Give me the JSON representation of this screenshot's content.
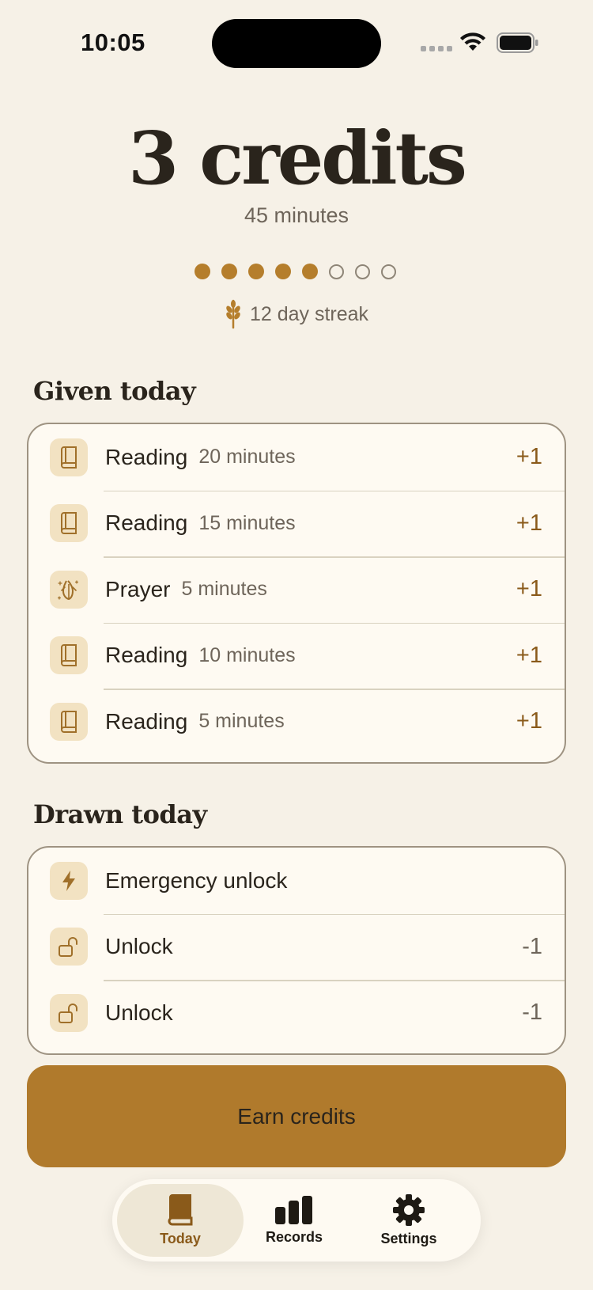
{
  "status_bar": {
    "time": "10:05"
  },
  "summary": {
    "credits_title": "3 credits",
    "minutes": "45 minutes",
    "progress": {
      "filled": 5,
      "total": 8
    },
    "streak": "12 day streak"
  },
  "given": {
    "title": "Given today",
    "rows": [
      {
        "icon": "book-icon",
        "label": "Reading",
        "sub": "20 minutes",
        "value": "+1"
      },
      {
        "icon": "book-icon",
        "label": "Reading",
        "sub": "15 minutes",
        "value": "+1"
      },
      {
        "icon": "praying-hands-icon",
        "label": "Prayer",
        "sub": "5 minutes",
        "value": "+1"
      },
      {
        "icon": "book-icon",
        "label": "Reading",
        "sub": "10 minutes",
        "value": "+1"
      },
      {
        "icon": "book-icon",
        "label": "Reading",
        "sub": "5 minutes",
        "value": "+1"
      }
    ]
  },
  "drawn": {
    "title": "Drawn today",
    "rows": [
      {
        "icon": "lightning-icon",
        "label": "Emergency unlock",
        "value": ""
      },
      {
        "icon": "unlock-icon",
        "label": "Unlock",
        "value": "-1"
      },
      {
        "icon": "unlock-icon",
        "label": "Unlock",
        "value": "-1"
      }
    ]
  },
  "earn_button": "Earn credits",
  "tabs": [
    {
      "label": "Today",
      "icon": "book-icon",
      "active": true
    },
    {
      "label": "Records",
      "icon": "bar-chart-icon",
      "active": false
    },
    {
      "label": "Settings",
      "icon": "gear-icon",
      "active": false
    }
  ],
  "colors": {
    "accent": "#B07A2C",
    "background": "#F6F1E7",
    "card": "#FEFAF2",
    "icon_tile": "#F2E2C2"
  }
}
